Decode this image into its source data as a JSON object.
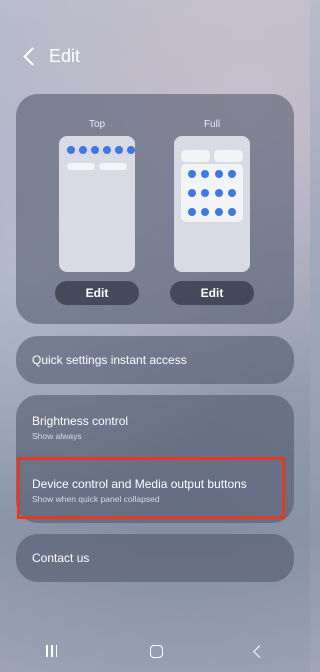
{
  "header": {
    "title": "Edit"
  },
  "layouts": [
    {
      "label": "Top",
      "edit_label": "Edit"
    },
    {
      "label": "Full",
      "edit_label": "Edit"
    }
  ],
  "quick_access": {
    "label": "Quick settings instant access"
  },
  "brightness": {
    "label": "Brightness control",
    "sub": "Show always"
  },
  "device_media": {
    "label": "Device control and Media output buttons",
    "sub": "Show when quick panel collapsed"
  },
  "contact": {
    "label": "Contact us"
  },
  "colors": {
    "accent": "#3f78e0",
    "highlight": "#e53a22"
  },
  "icons": {
    "back": "back-chevron-icon",
    "recent": "recent-apps-icon",
    "home": "home-icon",
    "nav_back": "nav-back-icon"
  }
}
